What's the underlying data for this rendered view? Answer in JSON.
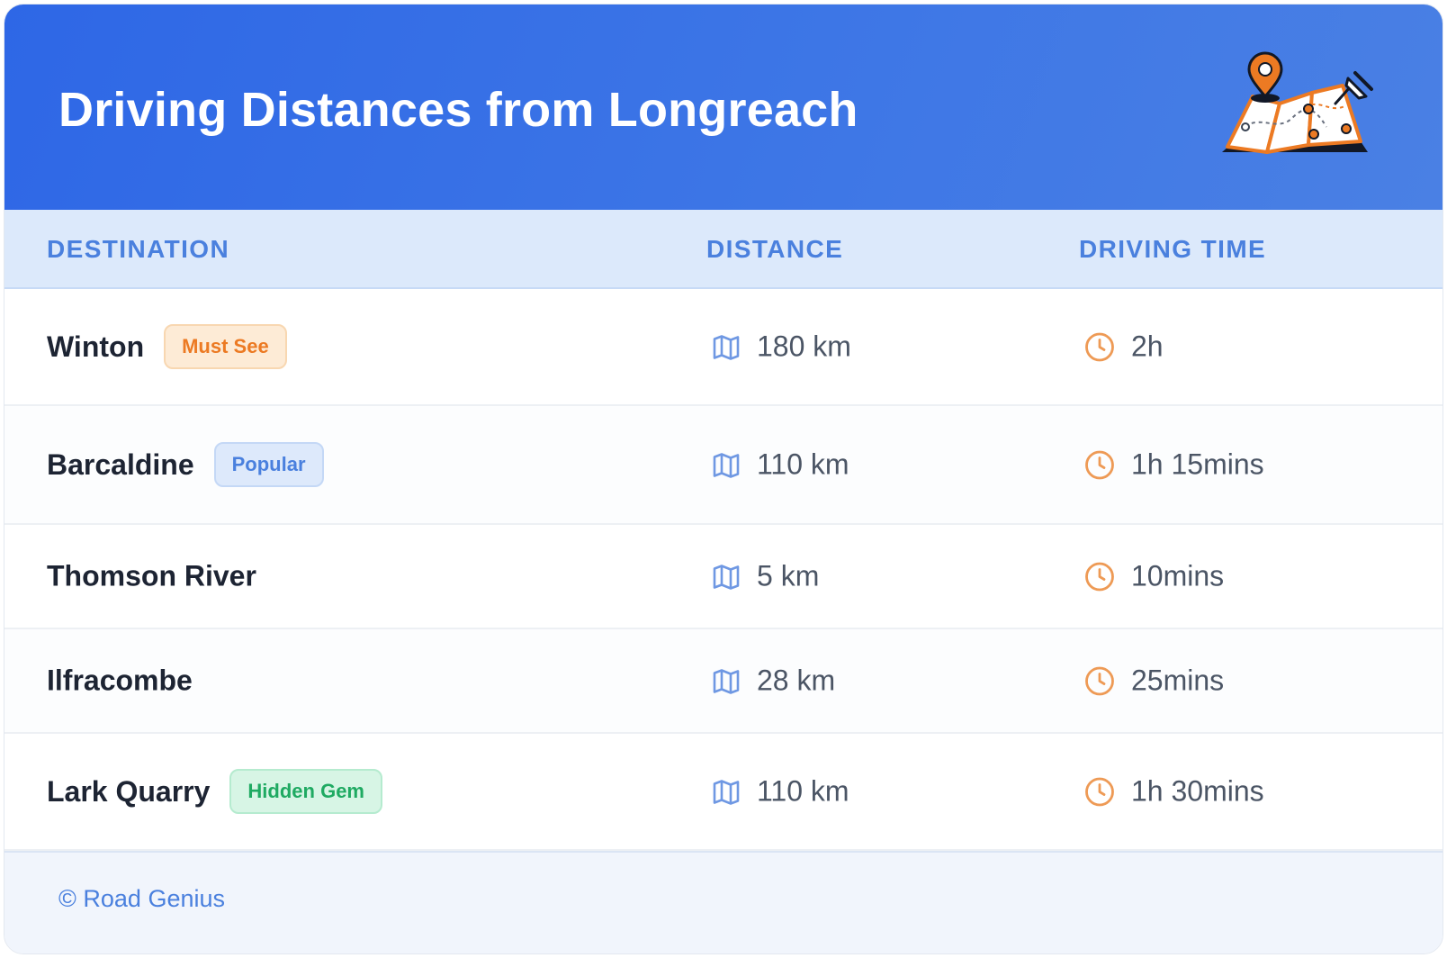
{
  "header": {
    "title": "Driving Distances from Longreach",
    "illustration_icon": "map-pin-icon",
    "colors": {
      "gradient_start": "#2e67e6",
      "gradient_end": "#4a80e4",
      "accent_orange": "#ec7a23"
    }
  },
  "table": {
    "columns": [
      "DESTINATION",
      "DISTANCE",
      "DRIVING TIME"
    ],
    "distance_icon": "map-icon",
    "time_icon": "clock-icon",
    "rows": [
      {
        "destination": "Winton",
        "badge": "Must See",
        "badge_color": "orange",
        "distance": "180 km",
        "time": "2h"
      },
      {
        "destination": "Barcaldine",
        "badge": "Popular",
        "badge_color": "blue",
        "distance": "110 km",
        "time": "1h 15mins"
      },
      {
        "destination": "Thomson River",
        "badge": "",
        "badge_color": "",
        "distance": "5 km",
        "time": "10mins"
      },
      {
        "destination": "Ilfracombe",
        "badge": "",
        "badge_color": "",
        "distance": "28 km",
        "time": "25mins"
      },
      {
        "destination": "Lark Quarry",
        "badge": "Hidden Gem",
        "badge_color": "green",
        "distance": "110 km",
        "time": "1h 30mins"
      }
    ]
  },
  "footer": {
    "text": "© Road Genius"
  }
}
